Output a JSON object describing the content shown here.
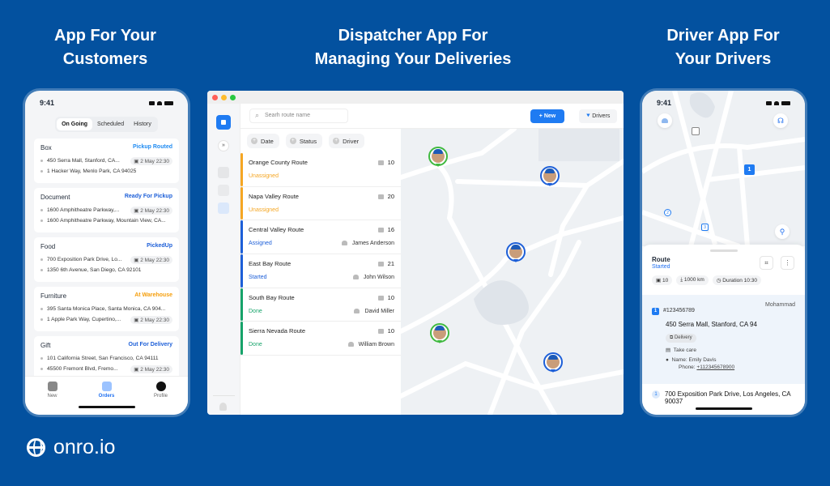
{
  "headings": {
    "customer": [
      "App For Your",
      "Customers"
    ],
    "dispatcher": [
      "Dispatcher App For",
      "Managing Your Deliveries"
    ],
    "driver": [
      "Driver App For",
      "Your Drivers"
    ]
  },
  "brand": {
    "name": "onro.io",
    "icon": "globe-icon"
  },
  "customer_app": {
    "time": "9:41",
    "tabs": [
      {
        "label": "On Going",
        "active": true
      },
      {
        "label": "Scheduled"
      },
      {
        "label": "History"
      }
    ],
    "orders": [
      {
        "type": "Box",
        "status": "Pickup Routed",
        "status_color": "#1f8bf2",
        "pickup": "450 Serra Mall, Stanford, CA...",
        "dropoff": "1 Hacker Way, Menlo Park, CA 94025",
        "date": "2 May 22:30",
        "date_on": "pickup"
      },
      {
        "type": "Document",
        "status": "Ready For Pickup",
        "status_color": "#1d5fd8",
        "pickup": "1600 Amphitheatre Parkway,...",
        "dropoff": "1600 Amphitheatre Parkway, Mountain View, CA...",
        "date": "2 May 22:30",
        "date_on": "pickup"
      },
      {
        "type": "Food",
        "status": "PickedUp",
        "status_color": "#1d5fd8",
        "pickup": "700 Exposition Park Drive, Lo...",
        "dropoff": "1350 6th Avenue, San Diego, CA 92101",
        "date": "2 May 22:30",
        "date_on": "pickup"
      },
      {
        "type": "Furniture",
        "status": "At Warehouse",
        "status_color": "#f59e0b",
        "pickup": "395 Santa Monica Place, Santa Monica, CA 904...",
        "dropoff": "1 Apple Park Way, Cupertino,...",
        "date": "2 May 22:30",
        "date_on": "dropoff"
      },
      {
        "type": "Gift",
        "status": "Out For Delivery",
        "status_color": "#1d5fd8",
        "pickup": "101 California Street, San Francisco, CA 94111",
        "dropoff": "45500 Fremont Blvd, Fremo...",
        "date": "2 May 22:30",
        "date_on": "dropoff"
      }
    ],
    "nav": [
      {
        "label": "New",
        "icon": "new-order-icon"
      },
      {
        "label": "Orders",
        "icon": "orders-icon",
        "active": true
      },
      {
        "label": "Profile",
        "icon": "profile-icon"
      }
    ]
  },
  "dispatcher_app": {
    "search_placeholder": "Searh route name",
    "new_button": "New",
    "drivers_button": "Drivers",
    "filters": [
      "Date",
      "Status",
      "Driver"
    ],
    "routes": [
      {
        "name": "Orange County Route",
        "count": "10",
        "status": "Unassigned",
        "color": "#f5a623",
        "driver": ""
      },
      {
        "name": "Napa Valley Route",
        "count": "20",
        "status": "Unassigned",
        "color": "#f5a623",
        "driver": ""
      },
      {
        "name": "Central Valley Route",
        "count": "16",
        "status": "Assigned",
        "color": "#1d5fd8",
        "driver": "James Anderson"
      },
      {
        "name": "East Bay Route",
        "count": "21",
        "status": "Started",
        "color": "#1d5fd8",
        "driver": "John Wilson"
      },
      {
        "name": "South Bay Route",
        "count": "10",
        "status": "Done",
        "color": "#16a36a",
        "driver": "David Miller"
      },
      {
        "name": "Sierra Nevada Route",
        "count": "10",
        "status": "Done",
        "color": "#16a36a",
        "driver": "William Brown"
      }
    ],
    "map_pins": [
      {
        "status_color": "#3fb93f"
      },
      {
        "status_color": "#1d5fd8"
      },
      {
        "status_color": "#1d5fd8"
      },
      {
        "status_color": "#3fb93f"
      },
      {
        "status_color": "#1d5fd8"
      }
    ]
  },
  "driver_app": {
    "time": "9:41",
    "map_markers": [
      "1",
      "2",
      "3"
    ],
    "route": {
      "title": "Route",
      "status": "Started",
      "stops": "10",
      "distance": "1000 km",
      "duration": "Duration 10:30"
    },
    "stop": {
      "number": "1",
      "id": "#123456789",
      "driver": "Mohammad",
      "address": "450 Serra Mall, Stanford, CA 94",
      "type": "Delivery",
      "note": "Take care",
      "name": "Name: Emily Davis",
      "phone_label": "Phone: ",
      "phone": "+112345678900"
    },
    "next_stop": {
      "number": "1",
      "address": "700 Exposition Park Drive, Los Angeles, CA 90037"
    }
  }
}
